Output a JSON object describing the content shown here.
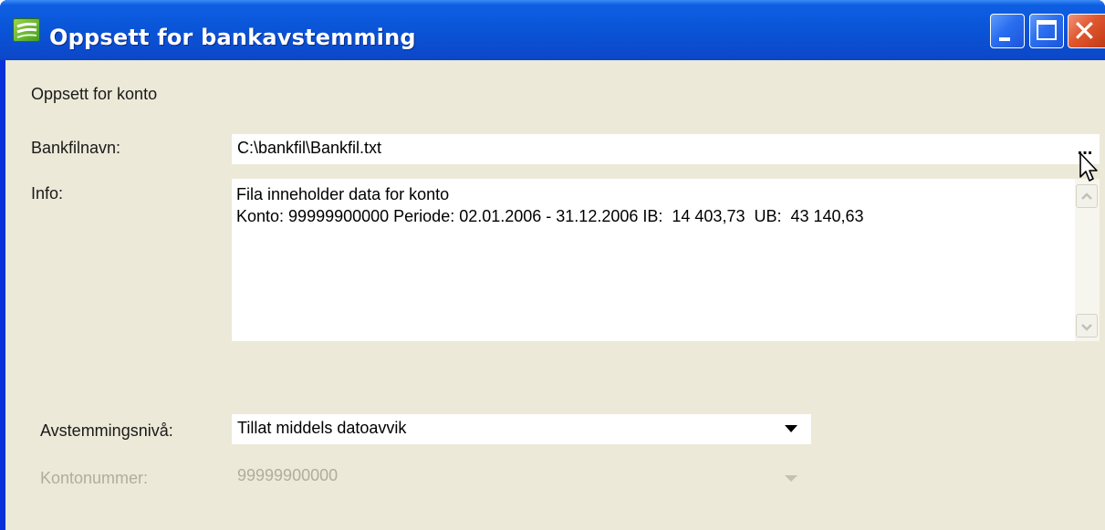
{
  "window": {
    "title": "Oppsett for bankavstemming",
    "app_icon": "app-logo-icon",
    "controls": {
      "minimize": "minimize-icon",
      "maximize": "maximize-icon",
      "close_glyph": "✕"
    }
  },
  "section_header": "Oppsett for konto",
  "bankfile": {
    "label": "Bankfilnavn:",
    "value": "C:\\bankfil\\Bankfil.txt",
    "browse_label": "..."
  },
  "info": {
    "label": "Info:",
    "lines": [
      "Fila inneholder data for konto",
      "Konto: 99999900000 Periode: 02.01.2006 - 31.12.2006 IB:  14 403,73  UB:  43 140,63"
    ]
  },
  "reconciliation_level": {
    "label": "Avstemmingsnivå:",
    "value": "Tillat middels datoavvik"
  },
  "account_number": {
    "label": "Kontonummer:",
    "value": "99999900000",
    "disabled": true
  },
  "colors": {
    "titlebar": "#0a55d8",
    "client_bg": "#ece9d8",
    "disabled_text": "#b0ad9f",
    "close_button": "#e0572f"
  }
}
